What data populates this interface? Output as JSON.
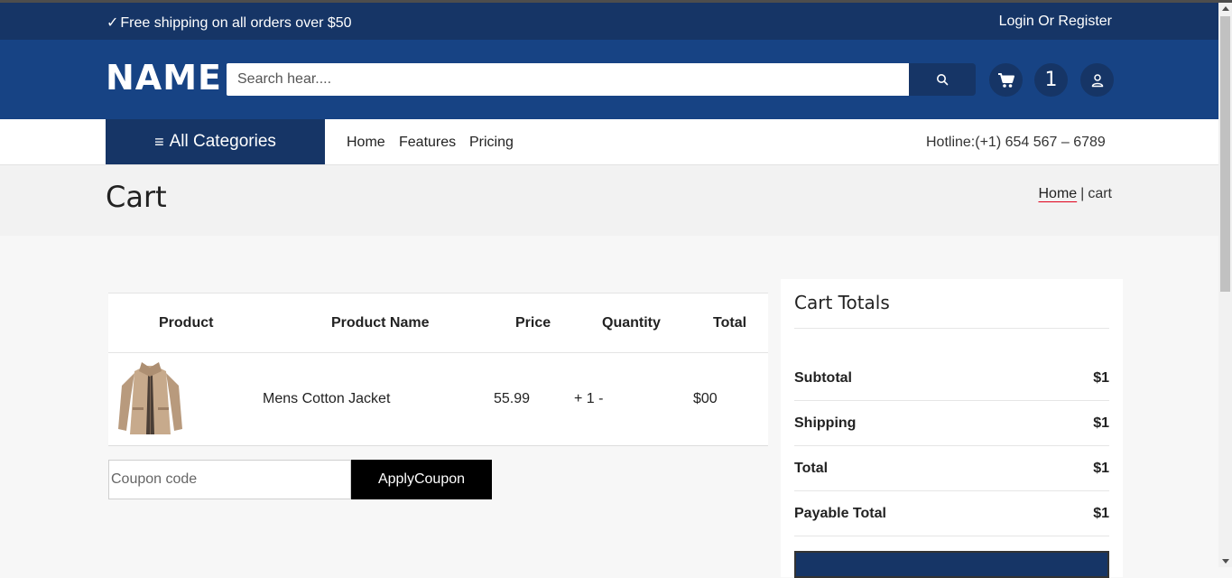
{
  "topbar": {
    "shipping_text": "Free shipping on all orders over $50",
    "login_text": "Login Or Register",
    "icons": {
      "check": "check-icon"
    }
  },
  "header": {
    "logo": "NAME",
    "search_placeholder": "Search hear....",
    "cart_count": "1",
    "icons": {
      "search": "search-icon",
      "cart": "cart-icon",
      "user": "user-icon"
    }
  },
  "nav": {
    "all_categories": "All Categories",
    "links": [
      "Home",
      "Features",
      "Pricing"
    ],
    "hotline": "Hotline:(+1) 654 567 – 6789",
    "icons": {
      "menu": "menu-icon"
    }
  },
  "page": {
    "title": "Cart",
    "breadcrumb": {
      "home": "Home",
      "separator": "|",
      "current": "cart"
    }
  },
  "cart": {
    "headers": [
      "Product",
      "Product Name",
      "Price",
      "Quantity",
      "Total"
    ],
    "rows": [
      {
        "name": "Mens Cotton Jacket",
        "price": "55.99",
        "quantity": "+ 1 -",
        "total": "$00",
        "image": "jacket-image"
      }
    ],
    "coupon_placeholder": "Coupon code",
    "apply_button": "ApplyCoupon"
  },
  "totals": {
    "title": "Cart Totals",
    "rows": [
      {
        "label": "Subtotal",
        "value": "$1"
      },
      {
        "label": "Shipping",
        "value": "$1"
      },
      {
        "label": "Total",
        "value": "$1"
      },
      {
        "label": "Payable Total",
        "value": "$1"
      }
    ]
  },
  "colors": {
    "topbar": "#163566",
    "header": "#174384",
    "accent_underline": "#e0001a"
  }
}
